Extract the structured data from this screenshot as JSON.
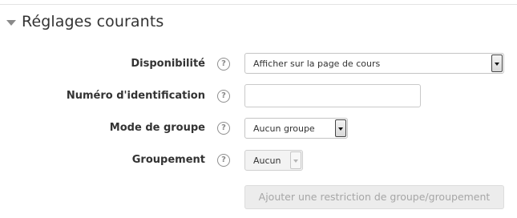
{
  "section": {
    "title": "Réglages courants"
  },
  "fields": {
    "availability": {
      "label": "Disponibilité",
      "value": "Afficher sur la page de cours"
    },
    "id_number": {
      "label": "Numéro d'identification",
      "value": ""
    },
    "group_mode": {
      "label": "Mode de groupe",
      "value": "Aucun groupe"
    },
    "grouping": {
      "label": "Groupement",
      "value": "Aucun"
    }
  },
  "help_icon": {
    "glyph": "?"
  },
  "restriction_button": {
    "label": "Ajouter une restriction de groupe/groupement"
  }
}
